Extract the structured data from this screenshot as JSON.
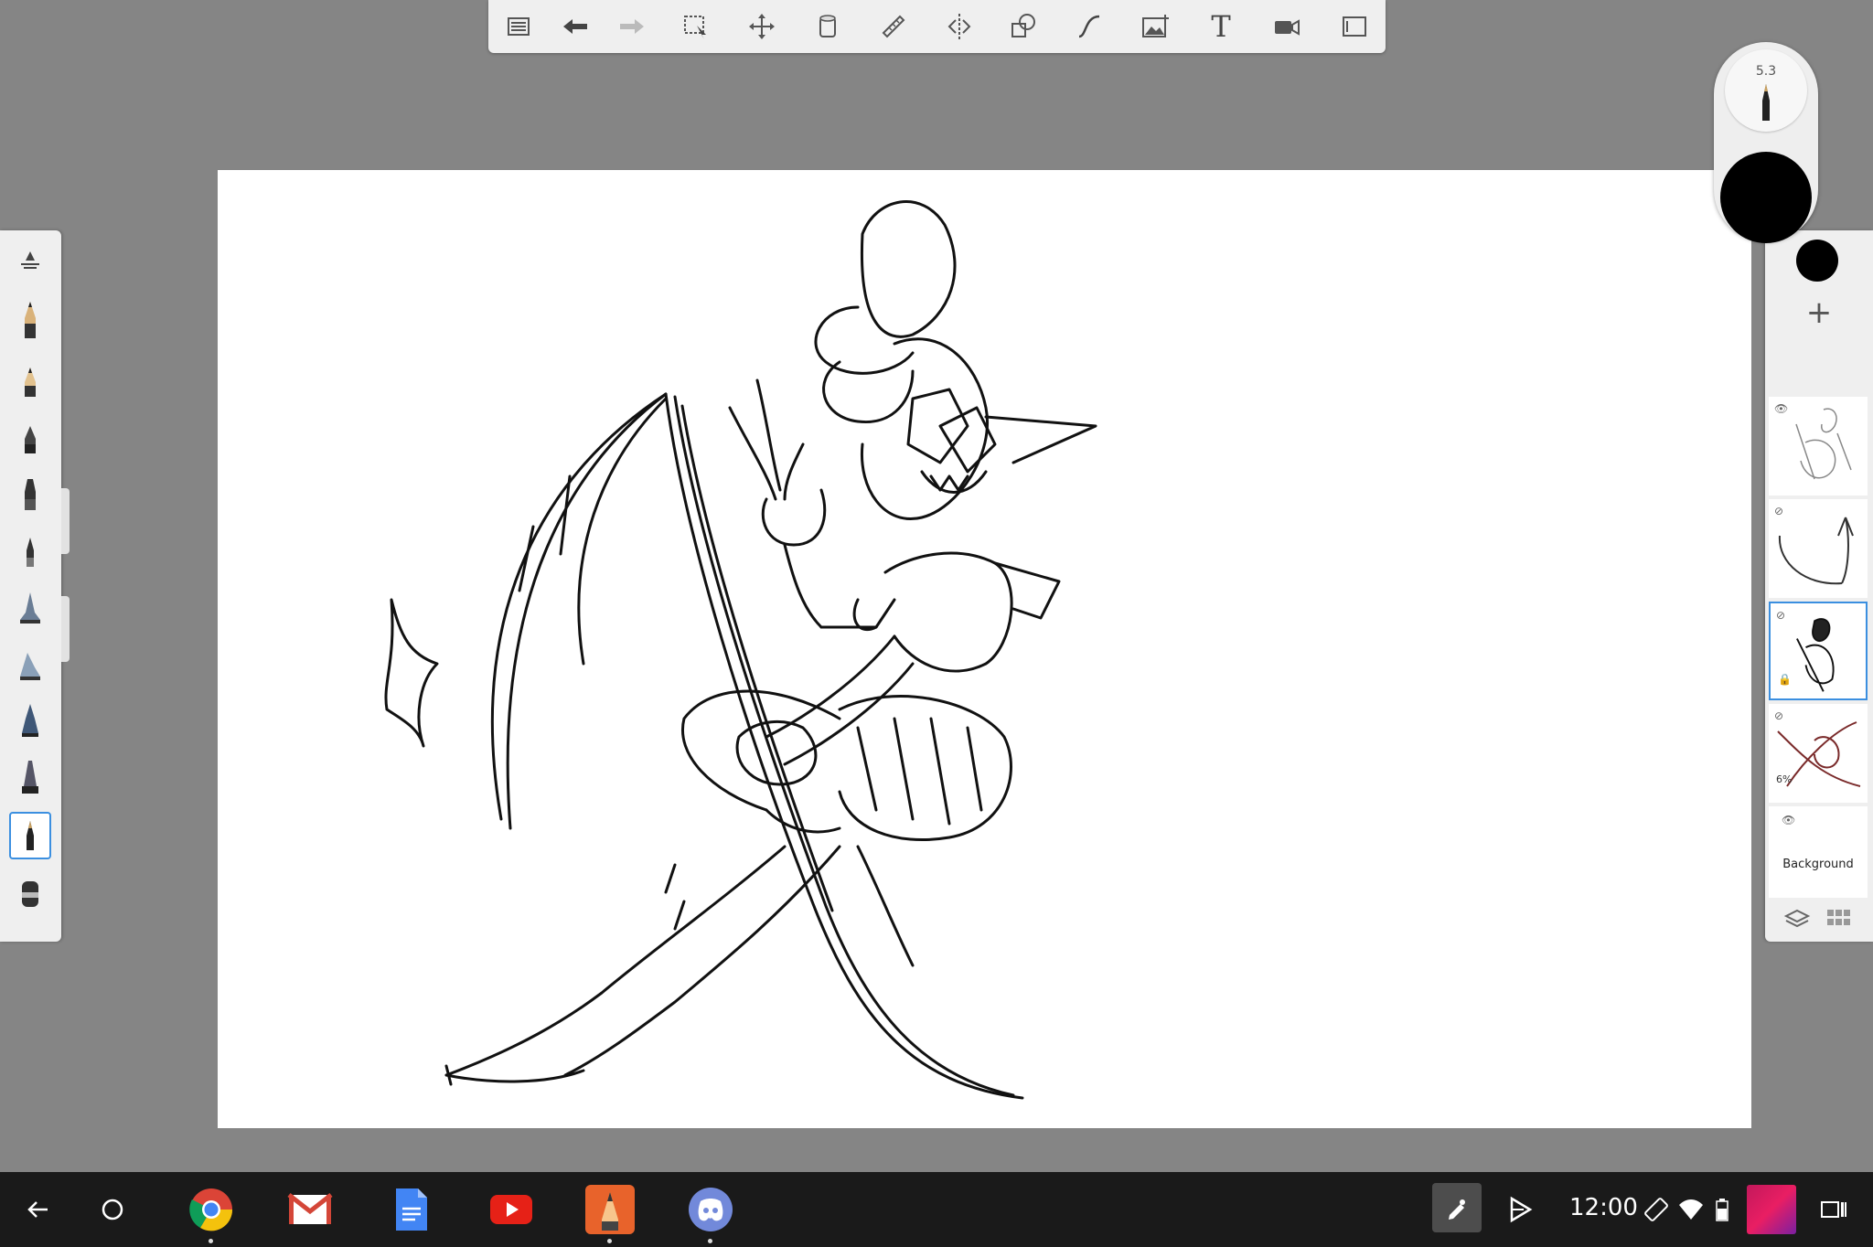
{
  "toolbar": {
    "tools": [
      {
        "name": "lists-menu",
        "icon": "list-icon"
      },
      {
        "name": "undo",
        "icon": "undo-arrow-icon"
      },
      {
        "name": "redo",
        "icon": "redo-arrow-icon"
      },
      {
        "name": "selection",
        "icon": "selection-icon"
      },
      {
        "name": "transform",
        "icon": "move-icon"
      },
      {
        "name": "fill",
        "icon": "fill-bucket-icon"
      },
      {
        "name": "ruler",
        "icon": "ruler-icon"
      },
      {
        "name": "symmetry",
        "icon": "symmetry-icon"
      },
      {
        "name": "shapes",
        "icon": "shapes-icon"
      },
      {
        "name": "curve",
        "icon": "curve-icon"
      },
      {
        "name": "import-image",
        "icon": "image-icon"
      },
      {
        "name": "text",
        "icon": "text-icon"
      },
      {
        "name": "record",
        "icon": "video-camera-icon"
      },
      {
        "name": "fullscreen",
        "icon": "fullscreen-icon"
      }
    ],
    "text_glyph": "T"
  },
  "brush_palette": {
    "brushes": [
      "brush-settings-icon",
      "pencil-icon",
      "hard-pencil-icon",
      "ballpoint-pen-icon",
      "marker-icon",
      "fineliner-icon",
      "airbrush-icon",
      "soft-airbrush-icon",
      "chisel-marker-icon",
      "paint-brush-icon",
      "ink-pen-icon",
      "smudge-icon"
    ],
    "selected_index": 10
  },
  "puck": {
    "brush_size": "5.3",
    "color": "#000000"
  },
  "layers": {
    "current_color": "#000000",
    "add_label": "+",
    "items": [
      {
        "name": "layer-sketch",
        "visible": true
      },
      {
        "name": "layer-scythe",
        "visible": false
      },
      {
        "name": "layer-ink",
        "visible": false,
        "selected": true
      },
      {
        "name": "layer-color-rough",
        "visible": false,
        "opacity": "6%"
      },
      {
        "name": "background",
        "label": "Background",
        "visible": true
      }
    ],
    "opacity_text": "6%"
  },
  "shelf": {
    "apps": [
      "chrome-icon",
      "gmail-icon",
      "docs-icon",
      "youtube-icon",
      "sketchbook-icon",
      "discord-icon"
    ],
    "clock": "12:00"
  },
  "colors": {
    "accent": "#3b8fe0",
    "background": "#858585",
    "shelf": "#1a1a1a"
  }
}
